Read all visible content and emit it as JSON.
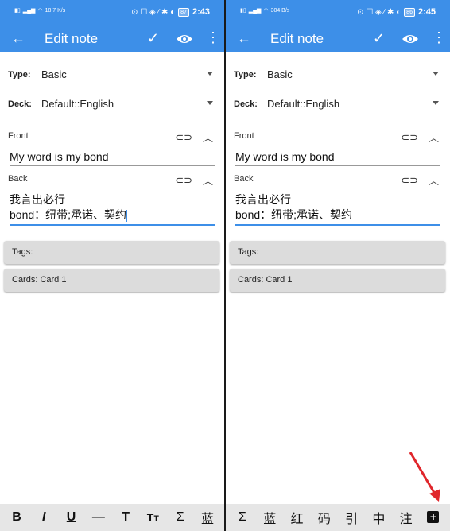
{
  "panels": [
    {
      "status": {
        "left_text": "18.7 K/s",
        "battery": "87",
        "time": "2:43"
      },
      "appbar": {
        "title": "Edit note"
      },
      "type_row": {
        "label": "Type:",
        "value": "Basic"
      },
      "deck_row": {
        "label": "Deck:",
        "value": "Default::English"
      },
      "front": {
        "label": "Front",
        "value": "My word is my bond"
      },
      "back": {
        "label": "Back",
        "line1": "我言出必行",
        "line2": "bond：纽带;承诺、契约"
      },
      "tags_label": "Tags:",
      "cards_label": "Cards: Card 1",
      "toolbar": [
        "B",
        "I",
        "U",
        "—",
        "T",
        "Tт",
        "Σ",
        "蓝"
      ]
    },
    {
      "status": {
        "left_text": "304 B/s",
        "battery": "86",
        "time": "2:45"
      },
      "appbar": {
        "title": "Edit note"
      },
      "type_row": {
        "label": "Type:",
        "value": "Basic"
      },
      "deck_row": {
        "label": "Deck:",
        "value": "Default::English"
      },
      "front": {
        "label": "Front",
        "value": "My word is my bond"
      },
      "back": {
        "label": "Back",
        "line1": "我言出必行",
        "line2": "bond：纽带;承诺、契约"
      },
      "tags_label": "Tags:",
      "cards_label": "Cards: Card 1",
      "toolbar": [
        "Σ",
        "蓝",
        "红",
        "码",
        "引",
        "中",
        "注",
        "+"
      ]
    }
  ],
  "colors": {
    "accent": "#3d8fe8",
    "annotation_arrow": "#e0262b"
  }
}
